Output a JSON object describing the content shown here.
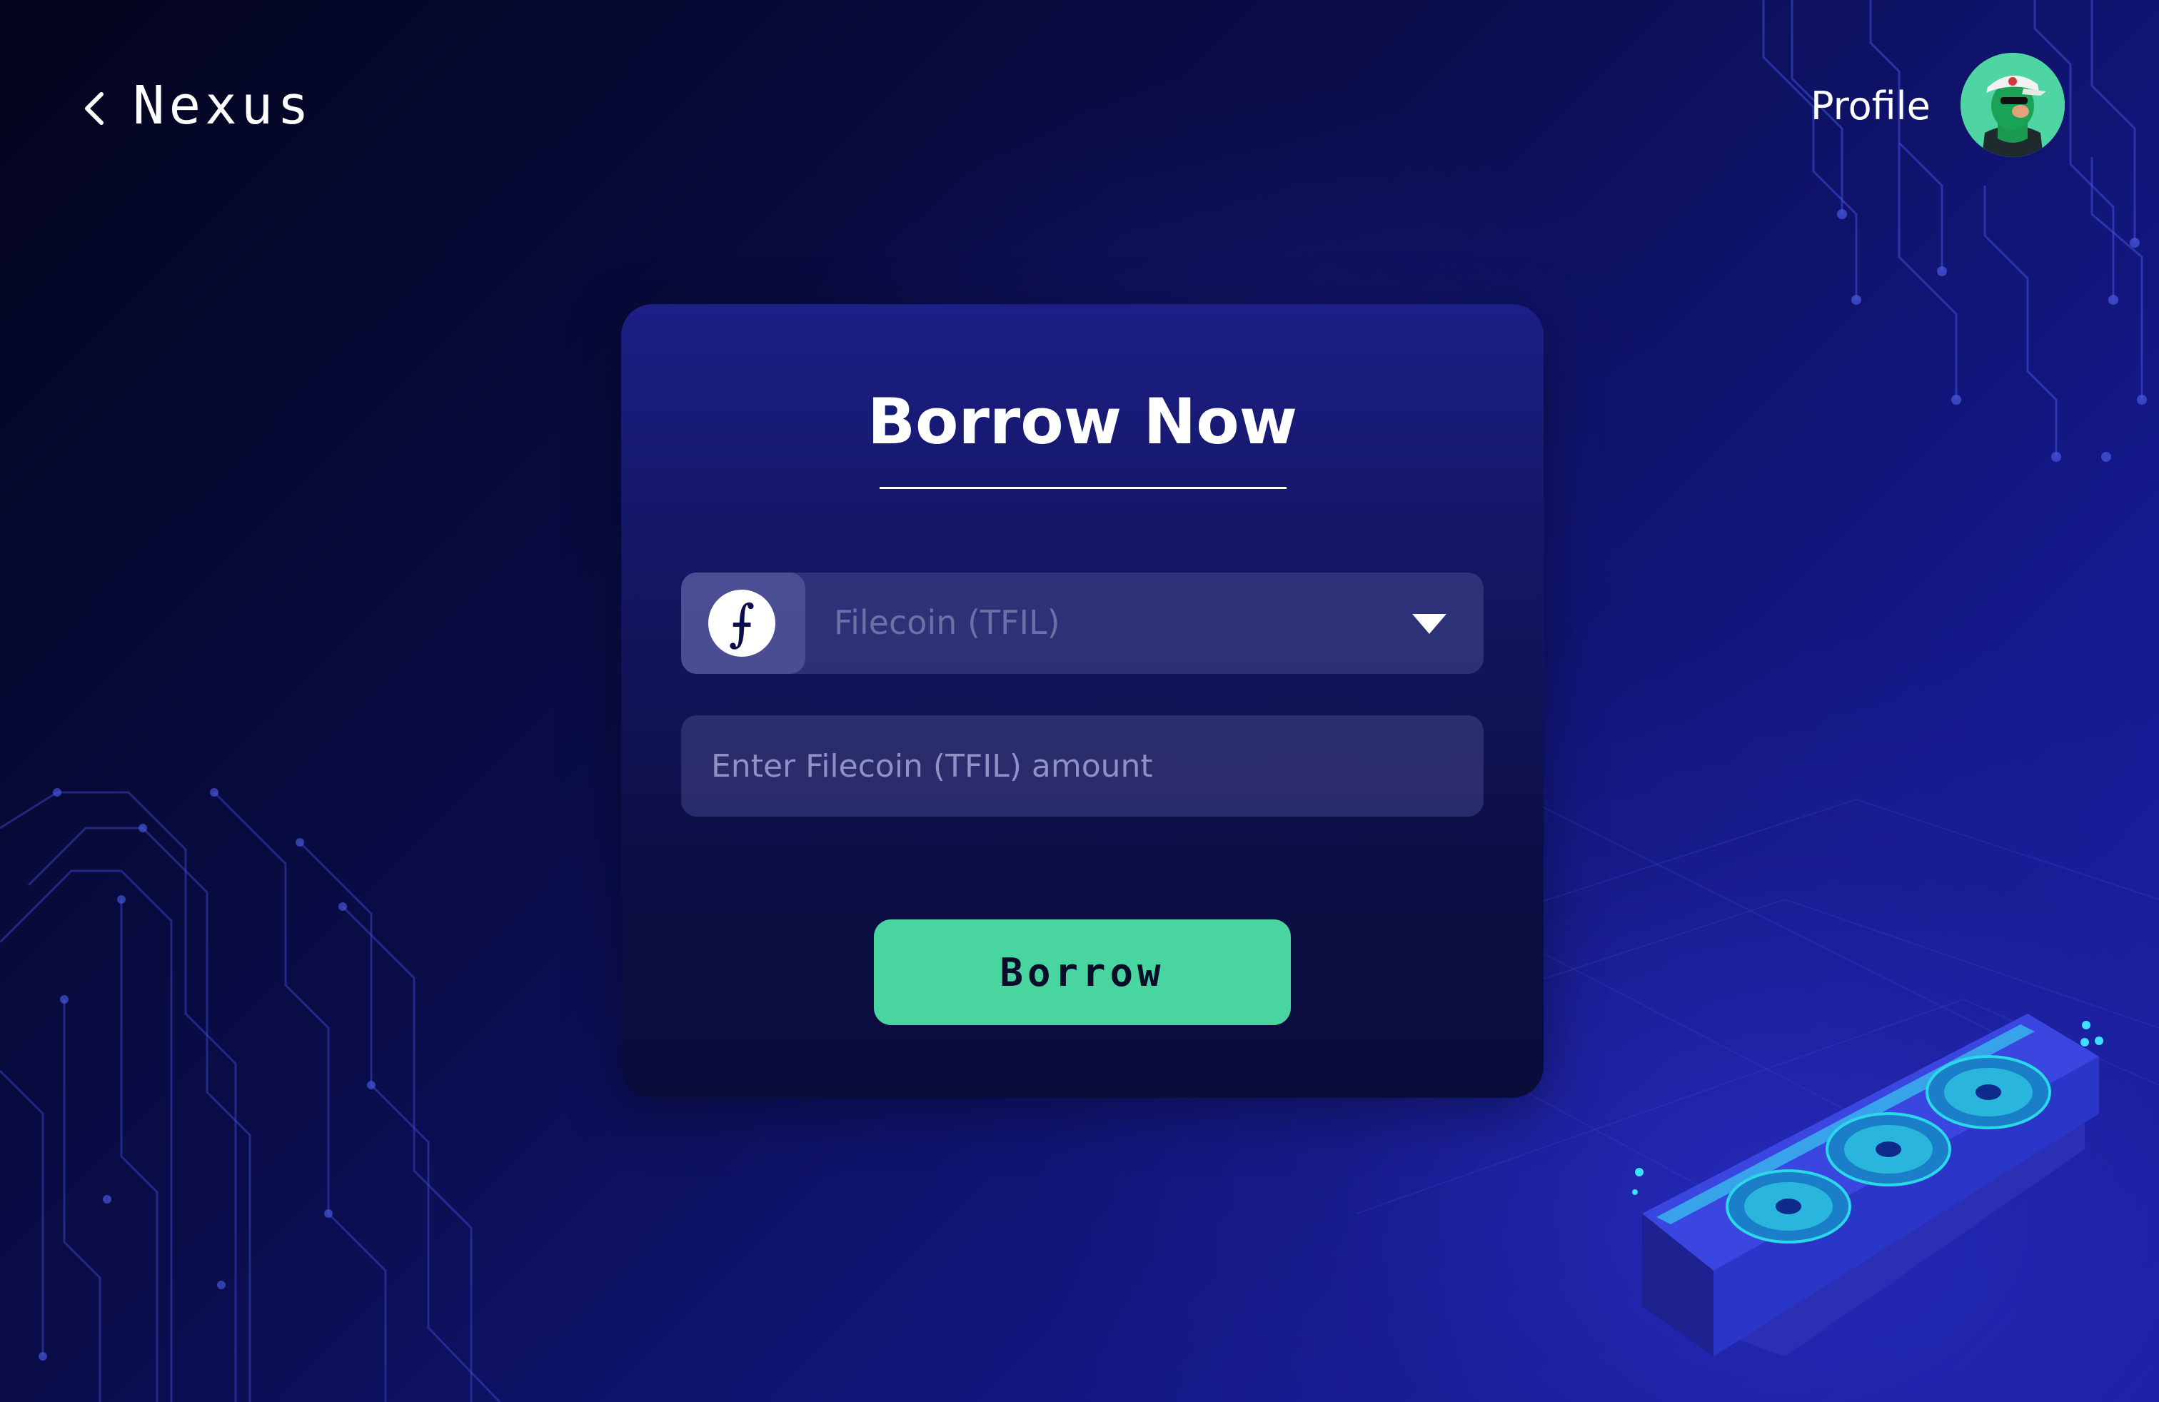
{
  "header": {
    "brand": "Nexus",
    "profile_label": "Profile"
  },
  "borrow_card": {
    "title": "Borrow Now",
    "token_select": {
      "selected": "Filecoin (TFIL)",
      "coin_symbol": "⨍"
    },
    "amount_input": {
      "placeholder": "Enter Filecoin (TFIL) amount",
      "value": ""
    },
    "submit_label": "Borrow"
  },
  "theme": {
    "background": "#0a0d4a",
    "card": "#141765",
    "accent": "#48d59f",
    "text": "#ffffff"
  }
}
